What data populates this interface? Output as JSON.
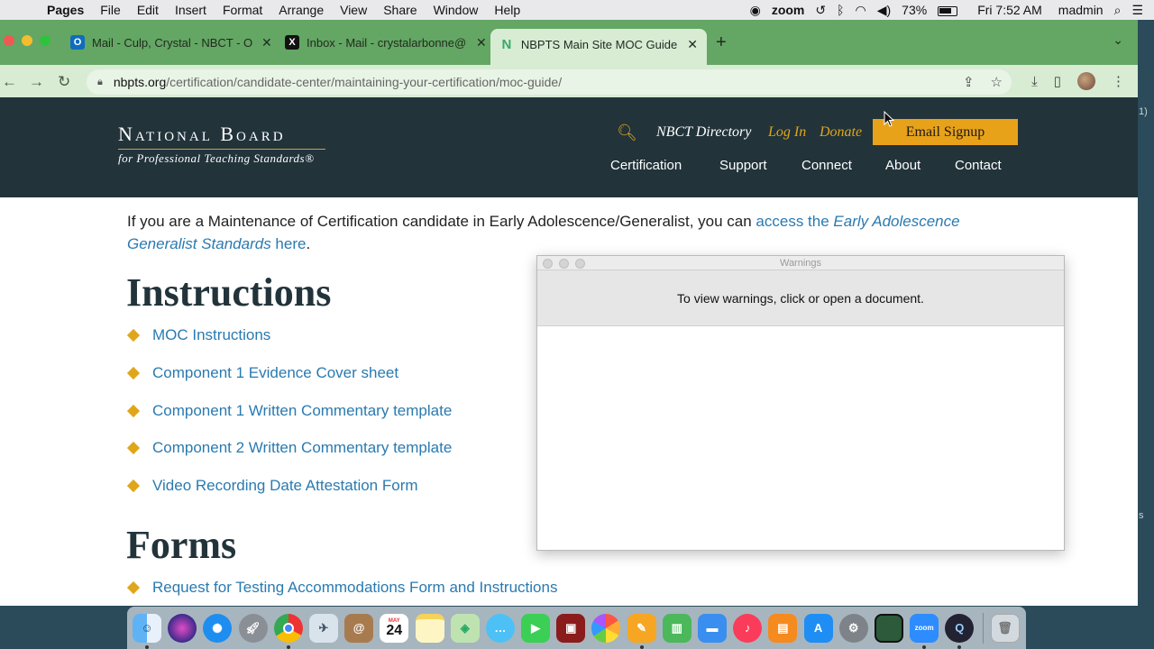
{
  "menubar": {
    "app": "Pages",
    "items": [
      "File",
      "Edit",
      "Insert",
      "Format",
      "Arrange",
      "View",
      "Share",
      "Window",
      "Help"
    ],
    "zoom": "zoom",
    "battery": "73%",
    "clock": "Fri 7:52 AM",
    "user": "madmin"
  },
  "browser": {
    "tabs": [
      {
        "favicon": "O",
        "title": "Mail - Culp, Crystal - NBCT - O"
      },
      {
        "favicon": "X",
        "title": "Inbox - Mail - crystalarbonne@"
      },
      {
        "favicon": "N",
        "title": "NBPTS Main Site MOC Guide, I"
      }
    ],
    "url_host": "nbpts.org",
    "url_path": "/certification/candidate-center/maintaining-your-certification/moc-guide/"
  },
  "site": {
    "logo_top": "National Board",
    "logo_bottom": "for Professional Teaching Standards®",
    "directory": "NBCT Directory",
    "login": "Log In",
    "donate": "Donate",
    "signup": "Email Signup",
    "nav": [
      "Certification",
      "Support",
      "Connect",
      "About",
      "Contact"
    ]
  },
  "content": {
    "intro_text": "If you are a Maintenance of Certification candidate in Early Adolescence/Generalist, you can ",
    "intro_link_a": "access the ",
    "intro_link_em": "Early Adolescence Generalist Standards",
    "intro_link_b": " here",
    "intro_end": ".",
    "instructions_heading": "Instructions",
    "instructions": [
      "MOC Instructions",
      "Component 1 Evidence Cover sheet",
      "Component 1 Written Commentary template",
      "Component 2 Written Commentary template",
      "Video Recording Date Attestation Form"
    ],
    "forms_heading": "Forms",
    "forms": [
      "Request for Testing Accommodations Form and Instructions"
    ]
  },
  "warnings": {
    "title": "Warnings",
    "message": "To view warnings, click or open a document."
  },
  "dock": {
    "apps": [
      "Finder",
      "Siri",
      "Safari",
      "Launchpad",
      "Chrome",
      "Preview",
      "Contacts",
      "Calendar",
      "Notes",
      "Maps",
      "Messages",
      "FaceTime",
      "Photo Booth",
      "Photos",
      "Pages",
      "Numbers",
      "Keynote",
      "Music",
      "Books",
      "App Store",
      "System Preferences",
      "Screen Share",
      "Zoom",
      "QuickTime",
      "Trash"
    ],
    "calendar_month": "MAY",
    "calendar_day": "24"
  },
  "colors": {
    "tabstrip": "#64a663",
    "header": "#22333a",
    "gold": "#e0a61a",
    "link": "#2a7ab0"
  }
}
